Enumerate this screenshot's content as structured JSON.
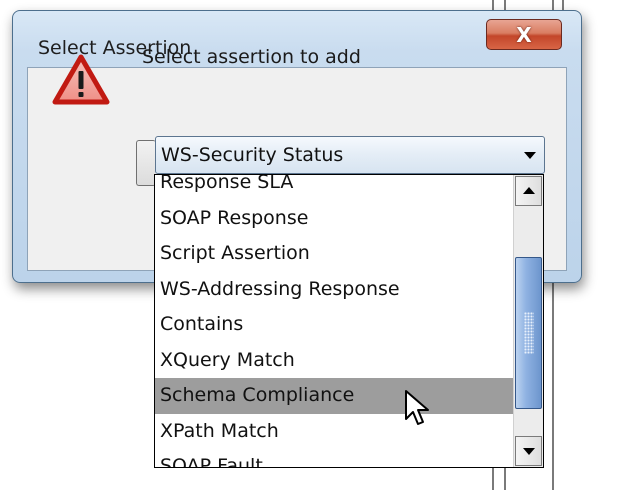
{
  "dialog": {
    "title": "Select Assertion",
    "close_label": "X",
    "prompt": "Select assertion to add"
  },
  "combo": {
    "selected": "WS-Security Status"
  },
  "dropdown": {
    "items": [
      "Response SLA",
      "SOAP Response",
      "Script Assertion",
      "WS-Addressing Response",
      "Contains",
      "XQuery Match",
      "Schema Compliance",
      "XPath Match",
      "SOAP Fault"
    ],
    "highlighted": "Schema Compliance"
  },
  "icons": {
    "warning": "warning-triangle-icon",
    "close": "close-icon",
    "cursor": "arrow-pointer-icon"
  }
}
